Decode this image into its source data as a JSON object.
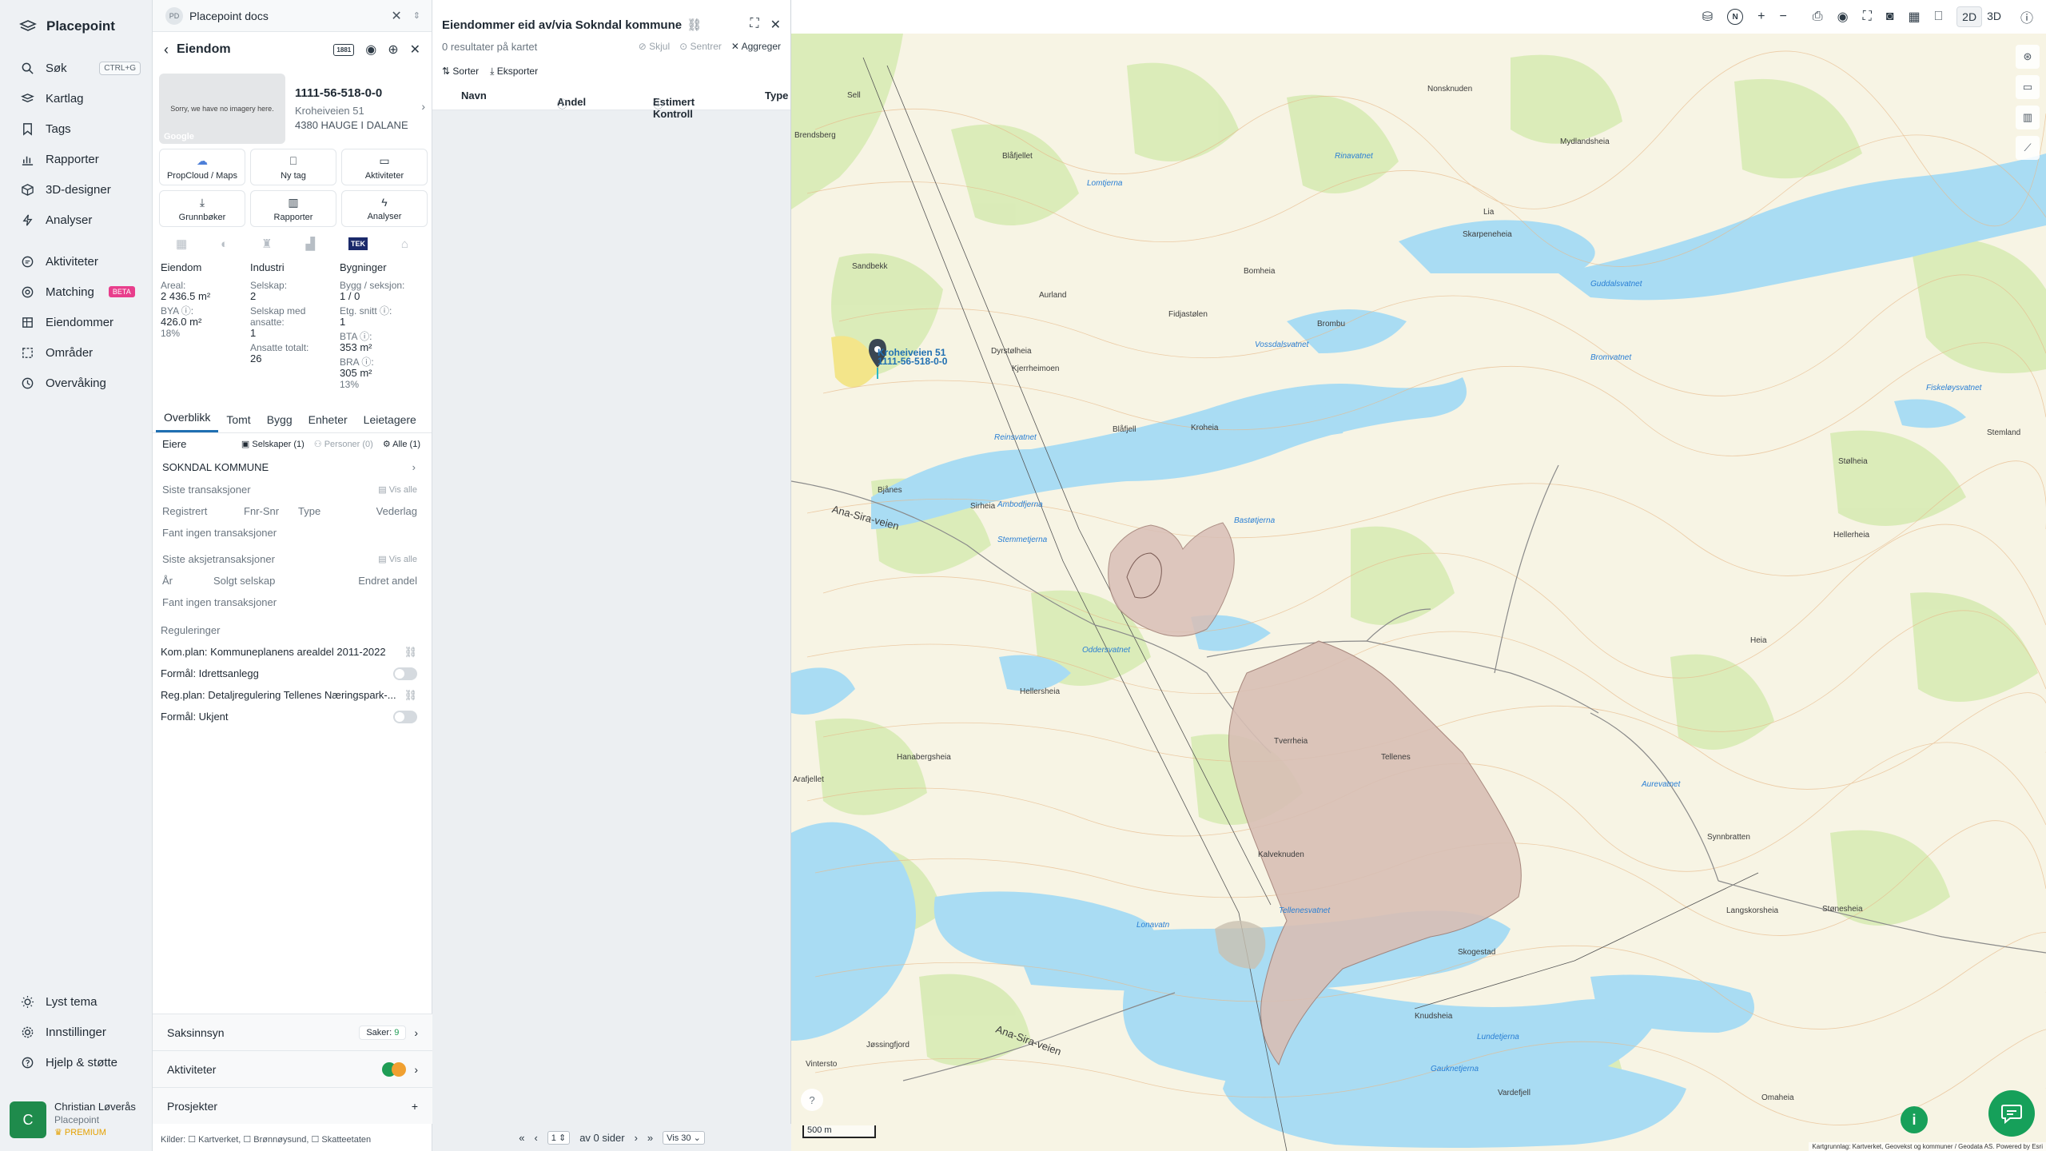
{
  "nav": {
    "brand": "Placepoint",
    "items": [
      {
        "label": "Søk",
        "icon": "search-icon",
        "shortcut": "CTRL+G"
      },
      {
        "label": "Kartlag",
        "icon": "layers-icon"
      },
      {
        "label": "Tags",
        "icon": "bookmark-icon"
      },
      {
        "label": "Rapporter",
        "icon": "chart-icon"
      },
      {
        "label": "3D-designer",
        "icon": "cube-icon"
      },
      {
        "label": "Analyser",
        "icon": "bolt-icon"
      }
    ],
    "items2": [
      {
        "label": "Aktiviteter",
        "icon": "chat-icon"
      },
      {
        "label": "Matching",
        "icon": "target-icon",
        "badge": "BETA"
      },
      {
        "label": "Eiendommer",
        "icon": "building-icon"
      },
      {
        "label": "Områder",
        "icon": "area-icon"
      },
      {
        "label": "Overvåking",
        "icon": "clock-icon"
      }
    ],
    "bottom": [
      {
        "label": "Lyst tema",
        "icon": "sun-icon"
      },
      {
        "label": "Innstillinger",
        "icon": "gear-icon"
      },
      {
        "label": "Hjelp & støtte",
        "icon": "help-icon"
      }
    ],
    "user": {
      "initial": "C",
      "name": "Christian Løverås",
      "org": "Placepoint",
      "plan": "PREMIUM"
    }
  },
  "doc_tab": {
    "badge": "PD",
    "title": "Placepoint docs"
  },
  "property": {
    "header": "Eiendom",
    "tag": "1881",
    "thumb_text": "Sorry, we have no imagery here.",
    "thumb_brand": "Google",
    "id": "1111-56-518-0-0",
    "address": "Kroheiveien 51",
    "city": "4380 HAUGE I DALANE",
    "actions": [
      {
        "label": "PropCloud / Maps",
        "icon": "cloud-icon",
        "glyph": "☁"
      },
      {
        "label": "Ny tag",
        "icon": "bookmark-icon",
        "glyph": "⎕"
      },
      {
        "label": "Aktiviteter",
        "icon": "chat-icon",
        "glyph": "▭"
      },
      {
        "label": "Grunnbøker",
        "icon": "download-icon",
        "glyph": "⤓"
      },
      {
        "label": "Rapporter",
        "icon": "chart-icon",
        "glyph": "▥"
      },
      {
        "label": "Analyser",
        "icon": "bolt-icon",
        "glyph": "ϟ"
      }
    ],
    "tek_label": "TEK",
    "facts": {
      "col1": {
        "title": "Eiendom",
        "areal_label": "Areal:",
        "areal": "2 436.5",
        "areal_unit": "m²",
        "bya_label": "BYA ⓘ:",
        "bya": "426.0",
        "bya_unit": "m²",
        "bya_pct": "18%"
      },
      "col2": {
        "title": "Industri",
        "selskap_label": "Selskap:",
        "selskap": "2",
        "ansatte_label": "Selskap med ansatte:",
        "ansatte": "1",
        "totalt_label": "Ansatte totalt:",
        "totalt": "26"
      },
      "col3": {
        "title": "Bygninger",
        "bygg_label": "Bygg / seksjon:",
        "bygg": "1 / 0",
        "etg_label": "Etg. snitt ⓘ:",
        "etg": "1",
        "bta_label": "BTA ⓘ:",
        "bta": "353",
        "bta_unit": "m²",
        "bra_label": "BRA ⓘ:",
        "bra": "305",
        "bra_unit": "m²",
        "bra_pct": "13%"
      }
    },
    "tabs": [
      "Overblikk",
      "Tomt",
      "Bygg",
      "Enheter",
      "Leietagere"
    ],
    "owners": {
      "label": "Eiere",
      "filters": [
        "Selskaper (1)",
        "Personer (0)",
        "Alle (1)"
      ],
      "owner": "SOKNDAL KOMMUNE"
    },
    "transactions": {
      "title": "Siste transaksjoner",
      "show_all": "Vis alle",
      "cols": [
        "Registrert",
        "Fnr-Snr",
        "Type",
        "Vederlag"
      ],
      "empty": "Fant ingen transaksjoner"
    },
    "share_transactions": {
      "title": "Siste aksjetransaksjoner",
      "show_all": "Vis alle",
      "cols": [
        "År",
        "Solgt selskap",
        "Endret andel"
      ],
      "empty": "Fant ingen transaksjoner"
    },
    "regulations": {
      "title": "Reguleringer",
      "items": [
        {
          "text": "Kom.plan: Kommuneplanens arealdel 2011-2022",
          "kind": "link"
        },
        {
          "text": "Formål: Idrettsanlegg",
          "kind": "toggle"
        },
        {
          "text": "Reg.plan: Detaljregulering Tellenes Næringspark-...",
          "kind": "link"
        },
        {
          "text": "Formål: Ukjent",
          "kind": "toggle"
        }
      ]
    },
    "bottom_rows": {
      "saksinnsyn": "Saksinnsyn",
      "saker_label": "Saker:",
      "saker_count": "9",
      "aktiviteter": "Aktiviteter",
      "prosjekter": "Prosjekter"
    },
    "kilder": "Kilder:  ☐ Kartverket,  ☐ Brønnøysund,  ☐ Skatteetaten"
  },
  "results": {
    "title": "Eiendommer eid av/via Sokndal kommune",
    "count_text": "0 resultater på kartet",
    "actions": [
      "Skjul",
      "Sentrer",
      "Aggreger"
    ],
    "tools": [
      "Sorter",
      "Eksporter"
    ],
    "columns": [
      "Navn",
      "Andel",
      "Estimert Kontroll",
      "Type"
    ],
    "pager": {
      "page": "1",
      "of_text": "av 0 sider",
      "per_page": "Vis 30"
    }
  },
  "toolbar": {
    "view_2d": "2D",
    "view_3d": "3D",
    "compass": "N"
  },
  "map": {
    "scale": "500 m",
    "pin_label_1": "Kroheiveien 51",
    "pin_label_2": "1111-56-518-0-0",
    "attribution": "Kartgrunnlag: Kartverket, Geovekst og kommuner / Geodata AS. Powered by Esri",
    "labels": [
      {
        "t": "Sell"
      },
      {
        "t": "Brendsberg"
      },
      {
        "t": "Blåfjellet"
      },
      {
        "t": "Nonsknuden"
      },
      {
        "t": "Mydlandsheia"
      },
      {
        "t": "Skarpeneheia"
      },
      {
        "t": "Lia"
      },
      {
        "t": "Bomheia"
      },
      {
        "t": "Sandbekk"
      },
      {
        "t": "Aurland"
      },
      {
        "t": "Fidjastølen"
      },
      {
        "t": "Brombu"
      },
      {
        "t": "Dyrstølheia"
      },
      {
        "t": "Kjerrheimoen"
      },
      {
        "t": "Blåfjell"
      },
      {
        "t": "Kroheia"
      },
      {
        "t": "Stølheia"
      },
      {
        "t": "Bjånes"
      },
      {
        "t": "Sirheia"
      },
      {
        "t": "Hellerheia"
      },
      {
        "t": "Heia"
      },
      {
        "t": "Tellenes"
      },
      {
        "t": "Tverrheia"
      },
      {
        "t": "Hanabergsheia"
      },
      {
        "t": "Arafjellet"
      },
      {
        "t": "Hellersheia"
      },
      {
        "t": "Kalveknuden"
      },
      {
        "t": "Skogestad"
      },
      {
        "t": "Synnbratten"
      },
      {
        "t": "Langskorsheia"
      },
      {
        "t": "Knudsheia"
      },
      {
        "t": "Vintersto"
      },
      {
        "t": "Jøssingfjord"
      },
      {
        "t": "Vardefjell"
      },
      {
        "t": "Omaheia"
      },
      {
        "t": "Stemland"
      },
      {
        "t": "Ana-Sira-veien"
      },
      {
        "t": "Ana-Sira-veien"
      },
      {
        "t": "Stønesheia"
      }
    ],
    "water_labels": [
      {
        "t": "Rinavatnet"
      },
      {
        "t": "Guddalsvatnet"
      },
      {
        "t": "Bromvatnet"
      },
      {
        "t": "Vossdalsvatnet"
      },
      {
        "t": "Fiskeløysvatnet"
      },
      {
        "t": "Ambodfjerna"
      },
      {
        "t": "Bastøtjerna"
      },
      {
        "t": "Oddersvatnet"
      },
      {
        "t": "Lonavatn"
      },
      {
        "t": "Tellenesvatnet"
      },
      {
        "t": "Lundetjerna"
      },
      {
        "t": "Gauknetjerna"
      },
      {
        "t": "Aurevatnet"
      },
      {
        "t": "Reinsvatnet"
      },
      {
        "t": "Lomtjerna"
      },
      {
        "t": "Stemmetjerna"
      }
    ]
  }
}
